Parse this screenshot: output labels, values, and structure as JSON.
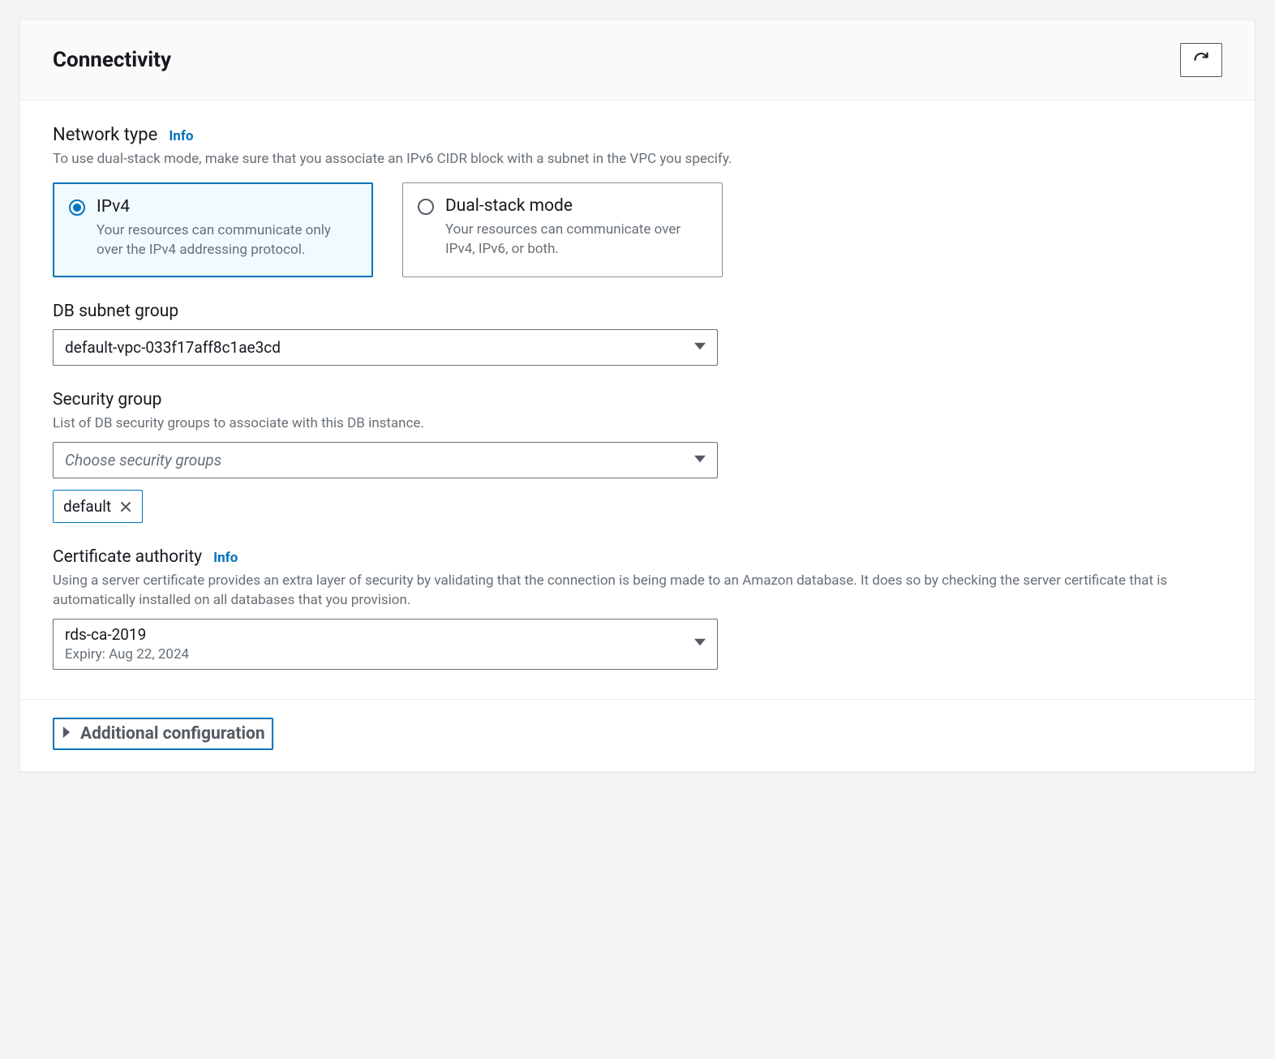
{
  "panel": {
    "title": "Connectivity"
  },
  "network_type": {
    "label": "Network type",
    "info": "Info",
    "desc": "To use dual-stack mode, make sure that you associate an IPv6 CIDR block with a subnet in the VPC you specify.",
    "options": [
      {
        "title": "IPv4",
        "desc": "Your resources can communicate only over the IPv4 addressing protocol.",
        "selected": true
      },
      {
        "title": "Dual-stack mode",
        "desc": "Your resources can communicate over IPv4, IPv6, or both.",
        "selected": false
      }
    ]
  },
  "db_subnet_group": {
    "label": "DB subnet group",
    "selected": "default-vpc-033f17aff8c1ae3cd"
  },
  "security_group": {
    "label": "Security group",
    "desc": "List of DB security groups to associate with this DB instance.",
    "placeholder": "Choose security groups",
    "tokens": [
      "default"
    ]
  },
  "certificate_authority": {
    "label": "Certificate authority",
    "info": "Info",
    "desc": "Using a server certificate provides an extra layer of security by validating that the connection is being made to an Amazon database. It does so by checking the server certificate that is automatically installed on all databases that you provision.",
    "selected": "rds-ca-2019",
    "expiry": "Expiry: Aug 22, 2024"
  },
  "footer": {
    "expander_label": "Additional configuration"
  }
}
